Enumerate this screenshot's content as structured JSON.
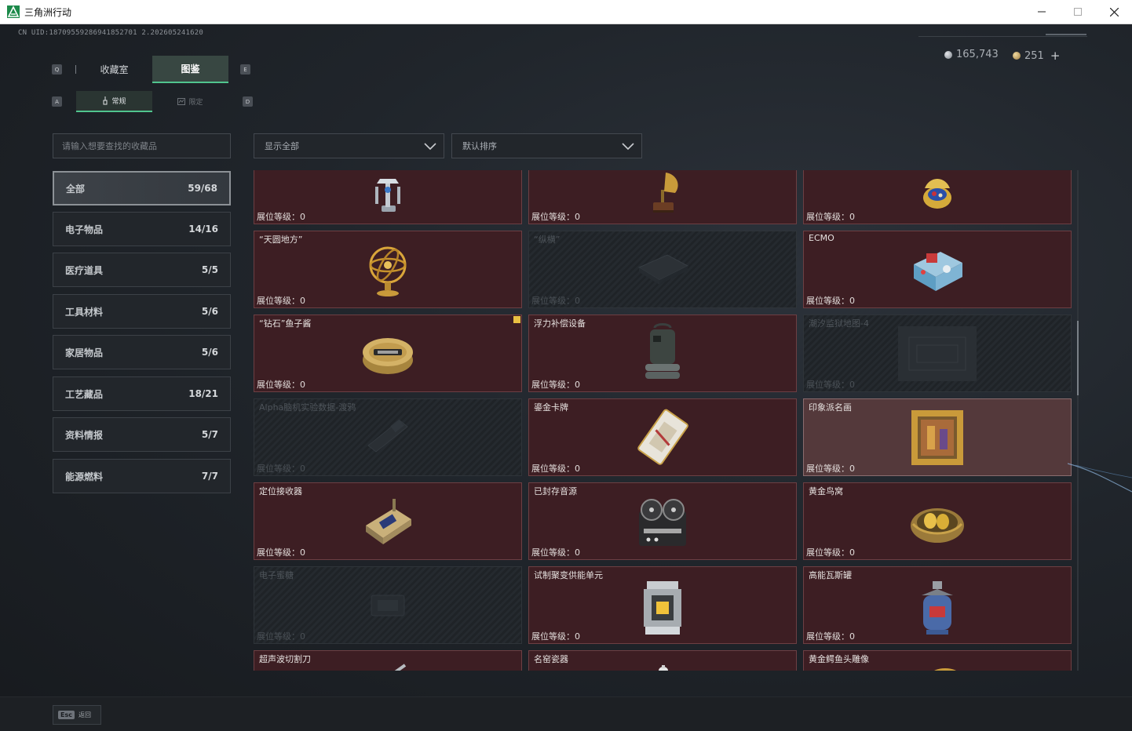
{
  "window": {
    "title": "三角洲行动",
    "controls": {
      "minimize": "—",
      "maximize": "☐",
      "close": "✕"
    }
  },
  "header": {
    "uid": "CN UID:18709559286941852701 2.202605241620",
    "currency": [
      {
        "icon": "silver-coin-icon",
        "value": "165,743"
      },
      {
        "icon": "gold-coin-icon",
        "value": "251"
      }
    ],
    "add_label": "+"
  },
  "tabs": {
    "key_left": "Q",
    "key_right": "E",
    "items": [
      {
        "label": "收藏室",
        "active": false
      },
      {
        "label": "图鉴",
        "active": true
      }
    ]
  },
  "subtabs": {
    "key_left": "A",
    "key_right": "D",
    "items": [
      {
        "label": "常规",
        "active": true
      },
      {
        "label": "限定",
        "active": false
      }
    ]
  },
  "search": {
    "placeholder": "请输入想要查找的收藏品"
  },
  "filters": {
    "display": "显示全部",
    "sort": "默认排序"
  },
  "categories": [
    {
      "label": "全部",
      "count": "59/68",
      "active": true
    },
    {
      "label": "电子物品",
      "count": "14/16",
      "active": false
    },
    {
      "label": "医疗道具",
      "count": "5/5",
      "active": false
    },
    {
      "label": "工具材料",
      "count": "5/6",
      "active": false
    },
    {
      "label": "家居物品",
      "count": "5/6",
      "active": false
    },
    {
      "label": "工艺藏品",
      "count": "18/21",
      "active": false
    },
    {
      "label": "资料情报",
      "count": "5/7",
      "active": false
    },
    {
      "label": "能源燃料",
      "count": "7/7",
      "active": false
    }
  ],
  "level_label": "展位等级：",
  "items": [
    {
      "name": "",
      "level": "0",
      "state": "owned",
      "icon": "robot-arm-icon"
    },
    {
      "name": "",
      "level": "0",
      "state": "owned",
      "icon": "gramophone-icon"
    },
    {
      "name": "",
      "level": "0",
      "state": "owned",
      "icon": "jeweled-egg-icon"
    },
    {
      "name": "“天圆地方”",
      "level": "0",
      "state": "owned",
      "icon": "armillary-sphere-icon"
    },
    {
      "name": "“纵横”",
      "level": "0",
      "state": "locked",
      "icon": "chessboard-icon"
    },
    {
      "name": "ECMO",
      "level": "0",
      "state": "owned",
      "icon": "ecmo-machine-icon"
    },
    {
      "name": "“钻石”鱼子酱",
      "level": "0",
      "state": "owned",
      "icon": "caviar-tin-icon",
      "badge": true
    },
    {
      "name": "浮力补偿设备",
      "level": "0",
      "state": "owned",
      "icon": "buoyancy-device-icon"
    },
    {
      "name": "潮汐监狱地图-4",
      "level": "0",
      "state": "locked",
      "icon": "map-icon"
    },
    {
      "name": "Alpha脑机实验数据-渡鸦",
      "level": "0",
      "state": "locked",
      "icon": "data-drive-icon"
    },
    {
      "name": "鎏金卡牌",
      "level": "0",
      "state": "owned",
      "icon": "gilded-card-icon"
    },
    {
      "name": "印象派名画",
      "level": "0",
      "state": "highlight",
      "icon": "framed-painting-icon"
    },
    {
      "name": "定位接收器",
      "level": "0",
      "state": "owned",
      "icon": "gps-receiver-icon"
    },
    {
      "name": "已封存音源",
      "level": "0",
      "state": "owned",
      "icon": "reel-recorder-icon"
    },
    {
      "name": "黄金鸟窝",
      "level": "0",
      "state": "owned",
      "icon": "golden-nest-icon"
    },
    {
      "name": "电子蜜糖",
      "level": "0",
      "state": "locked",
      "icon": "electronic-item-icon"
    },
    {
      "name": "试制聚变供能单元",
      "level": "0",
      "state": "owned",
      "icon": "fusion-cell-icon"
    },
    {
      "name": "高能瓦斯罐",
      "level": "0",
      "state": "owned",
      "icon": "gas-canister-icon"
    },
    {
      "name": "超声波切割刀",
      "level": "",
      "state": "owned",
      "icon": "ultrasonic-cutter-icon"
    },
    {
      "name": "名窑瓷器",
      "level": "",
      "state": "owned",
      "icon": "porcelain-icon"
    },
    {
      "name": "黄金鳄鱼头雕像",
      "level": "",
      "state": "owned",
      "icon": "golden-croc-statue-icon"
    }
  ],
  "footer": {
    "key": "Esc",
    "label": "返回"
  },
  "colors": {
    "accent": "#50c48e",
    "card_owned": "#3d1e23",
    "card_border": "#6c3f43",
    "badge": "#e8c042"
  }
}
